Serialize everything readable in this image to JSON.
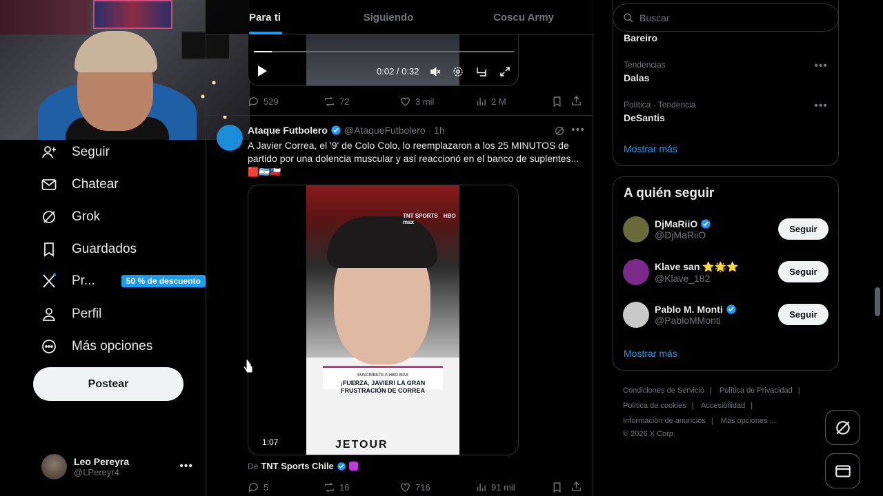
{
  "colors": {
    "accent": "#1d9bf0",
    "bg": "#000000",
    "text": "#e7e9ea",
    "muted": "#71767b",
    "border": "#2f3336"
  },
  "sidebar": {
    "items": [
      {
        "label": "Seguir",
        "icon": "person-add-icon"
      },
      {
        "label": "Chatear",
        "icon": "envelope-icon"
      },
      {
        "label": "Grok",
        "icon": "grok-icon"
      },
      {
        "label": "Guardados",
        "icon": "bookmark-icon"
      },
      {
        "label": "Pr...",
        "icon": "x-logo-icon",
        "badge": "50 % de descuento"
      },
      {
        "label": "Perfil",
        "icon": "person-icon"
      },
      {
        "label": "Más opciones",
        "icon": "more-circle-icon"
      }
    ],
    "post_button": "Postear",
    "user": {
      "name": "Leo Pereyra",
      "handle": "@LPereyr4"
    }
  },
  "tabs": [
    {
      "label": "Para ti",
      "active": true
    },
    {
      "label": "Siguiendo",
      "active": false
    },
    {
      "label": "Coscu Army",
      "active": false
    }
  ],
  "tweet1": {
    "video": {
      "time": "0:02 / 0:32",
      "progress": 0.07
    },
    "actions": {
      "replies": "529",
      "reposts": "72",
      "likes": "3 mil",
      "views": "2 M"
    }
  },
  "tweet2": {
    "author_name": "Ataque Futbolero",
    "author_handle": "@AtaqueFutbolero",
    "time": "· 1h",
    "text": "A Javier Correa, el '9' de Colo Colo, lo reemplazaron a los 25 MINUTOS de partido por una dolencia muscular y así reaccionó en el banco de suplentes...",
    "emojis": "🟥🇦🇷🇨🇱",
    "video": {
      "duration": "1:07",
      "overlay_small": "SUSCRÍBETE A HBO MAX",
      "overlay_title": "¡FUERZA, JAVIER! LA GRAN FRUSTRACIÓN DE CORREA",
      "channel_logo": "TNT SPORTS",
      "network_logo": "HBO max",
      "sponsor": "JETOUR"
    },
    "from_prefix": "De",
    "from_name": "TNT Sports Chile",
    "actions": {
      "replies": "5",
      "reposts": "16",
      "likes": "716",
      "views": "91 mil"
    }
  },
  "search": {
    "placeholder": "Buscar"
  },
  "trends": {
    "top_item": "Bareiro",
    "items": [
      {
        "meta": "Tendencias",
        "name": "Dalas"
      },
      {
        "meta": "Política · Tendencia",
        "name": "DeSantis"
      }
    ],
    "show_more": "Mostrar más"
  },
  "who_to_follow": {
    "title": "A quién seguir",
    "users": [
      {
        "name": "DjMaRiiO",
        "handle": "@DjMaRiiO",
        "verified": true,
        "suffix": "",
        "avatar_color": "#6b6a3a"
      },
      {
        "name": "Klave san",
        "handle": "@Klave_182",
        "verified": false,
        "suffix": "⭐🌟⭐",
        "avatar_color": "#7b2a8c"
      },
      {
        "name": "Pablo M. Monti",
        "handle": "@PabloMMonti",
        "verified": true,
        "suffix": "",
        "avatar_color": "#c9c9c9"
      }
    ],
    "follow_label": "Seguir",
    "show_more": "Mostrar más"
  },
  "footer": {
    "links": [
      "Condiciones de Servicio",
      "Política de Privacidad",
      "Política de cookies",
      "Accesibilidad",
      "Información de anuncios",
      "Más opciones ..."
    ],
    "copyright": "© 2026 X Corp."
  }
}
